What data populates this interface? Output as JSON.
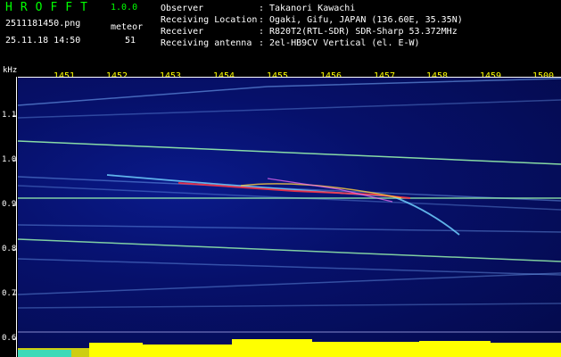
{
  "header": {
    "app_name": "HROFFT",
    "version": "1.0.0",
    "file_name": "2511181450.png",
    "meteor_label": "meteor",
    "datetime": "25.11.18 14:50",
    "meteor_count": "51"
  },
  "info": [
    {
      "key": "Observer",
      "sep": ":",
      "value": "Takanori Kawachi"
    },
    {
      "key": "Receiving Location",
      "sep": ":",
      "value": "Ogaki, Gifu, JAPAN (136.60E, 35.35N)"
    },
    {
      "key": "Receiver",
      "sep": ":",
      "value": "R820T2(RTL-SDR) SDR-Sharp 53.372MHz"
    },
    {
      "key": "Receiving antenna",
      "sep": ":",
      "value": "2el-HB9CV Vertical (el. E-W)"
    }
  ],
  "axis": {
    "unit_label": "kHz",
    "time_ticks": [
      "1451",
      "1452",
      "1453",
      "1454",
      "1455",
      "1456",
      "1457",
      "1458",
      "1459",
      "1500"
    ],
    "freq_ticks": [
      "1.1",
      "1.0",
      "0.9",
      "0.8",
      "0.7",
      "0.6"
    ]
  },
  "colors": {
    "background": "#000000",
    "title_green": "#00ff00",
    "tick_yellow": "#ffff00",
    "noise_blue": "#0a1a8a",
    "trace_green": "#a0ffa0",
    "meteor_red": "#ff3040"
  }
}
